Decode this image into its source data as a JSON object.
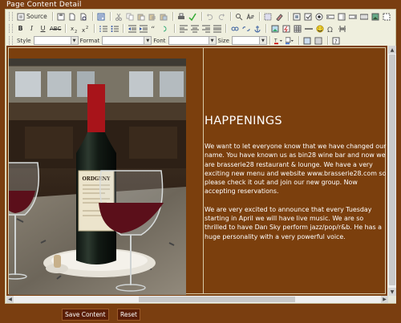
{
  "page": {
    "title": "Page Content Detail"
  },
  "toolbar": {
    "source_label": "Source",
    "style_label": "Style",
    "format_label": "Format",
    "font_label": "Font",
    "size_label": "Size",
    "row1_icons": [
      "save-icon",
      "new-page-icon",
      "preview-icon",
      "templates-icon",
      "cut-icon",
      "copy-icon",
      "paste-icon",
      "paste-text-icon",
      "paste-word-icon",
      "print-icon",
      "spellcheck-icon",
      "undo-icon",
      "redo-icon",
      "find-icon",
      "replace-icon",
      "select-all-icon",
      "remove-format-icon",
      "form-icon",
      "checkbox-icon",
      "radio-icon",
      "textfield-icon",
      "textarea-icon",
      "select-icon",
      "button-icon",
      "image-button-icon",
      "hidden-field-icon"
    ],
    "row2_icons": [
      "bold-icon",
      "italic-icon",
      "underline-icon",
      "strike-icon",
      "subscript-icon",
      "superscript-icon",
      "numbered-list-icon",
      "bulleted-list-icon",
      "outdent-icon",
      "indent-icon",
      "blockquote-icon",
      "align-left-icon",
      "align-center-icon",
      "align-right-icon",
      "justify-icon",
      "link-icon",
      "unlink-icon",
      "anchor-icon",
      "image-icon",
      "flash-icon",
      "table-icon",
      "horizontal-rule-icon",
      "smiley-icon",
      "special-char-icon",
      "page-break-icon"
    ],
    "row3_icons": [
      "text-color-icon",
      "background-color-icon",
      "maximize-icon",
      "show-blocks-icon",
      "about-icon"
    ]
  },
  "content": {
    "heading": "HAPPENINGS",
    "paragraph1": "We want to let everyone know that we have changed our name. You have known us as bin28 wine bar and now we are brasserie28 restaurant & lounge. We have a very exciting new menu and website www.brasserie28.com so please check it out and join our new group. Now accepting reservations.",
    "paragraph2": "We are very excited to announce that every Tuesday starting in April we will have live music.  We are so thrilled to have Dan Sky perform jazz/pop/r&b. He has a huge personality with a very powerful voice.",
    "bottle_label": "ORDGENY"
  },
  "buttons": {
    "save": "Save Content",
    "reset": "Reset"
  },
  "colors": {
    "background": "#7a3e10",
    "content_background": "#7b3f0d",
    "button": "#5a1e06"
  }
}
